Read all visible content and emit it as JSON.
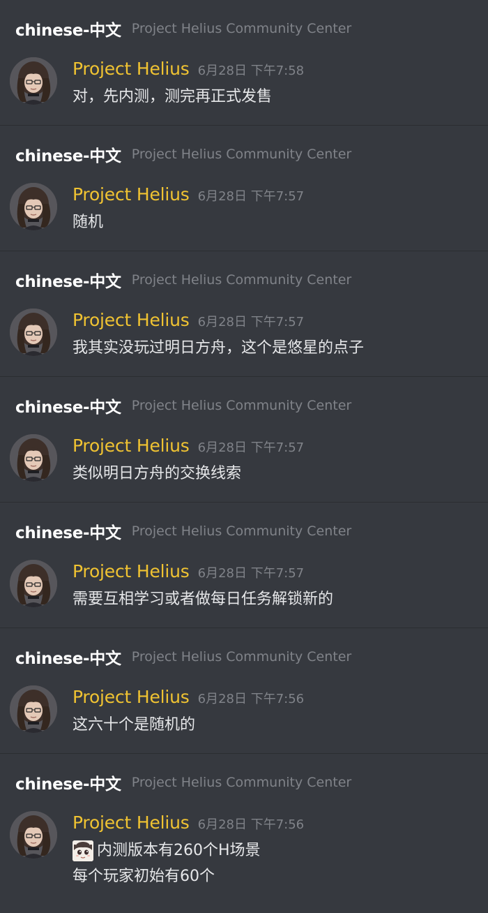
{
  "channel": "chinese-中文",
  "server": "Project Helius Community Center",
  "messages": [
    {
      "author": "Project Helius",
      "timestamp": "6月28日 下午7:58",
      "lines": [
        "对，先内测，测完再正式发售"
      ]
    },
    {
      "author": "Project Helius",
      "timestamp": "6月28日 下午7:57",
      "lines": [
        "随机"
      ]
    },
    {
      "author": "Project Helius",
      "timestamp": "6月28日 下午7:57",
      "lines": [
        "我其实没玩过明日方舟，这个是悠星的点子"
      ]
    },
    {
      "author": "Project Helius",
      "timestamp": "6月28日 下午7:57",
      "lines": [
        "类似明日方舟的交换线索"
      ]
    },
    {
      "author": "Project Helius",
      "timestamp": "6月28日 下午7:57",
      "lines": [
        "需要互相学习或者做每日任务解锁新的"
      ]
    },
    {
      "author": "Project Helius",
      "timestamp": "6月28日 下午7:56",
      "lines": [
        "这六十个是随机的"
      ]
    },
    {
      "author": "Project Helius",
      "timestamp": "6月28日 下午7:56",
      "emoji": "anime-face-sticker",
      "lines": [
        "内测版本有260个H场景",
        "每个玩家初始有60个"
      ]
    }
  ],
  "colors": {
    "background": "#36393f",
    "divider": "#2b2d31",
    "author": "#f0c332",
    "muted": "#808389",
    "text": "#e6e7e9"
  },
  "icons": {
    "avatar": "anime-girl-avatar",
    "inline_emoji": "anime-face-sticker"
  }
}
